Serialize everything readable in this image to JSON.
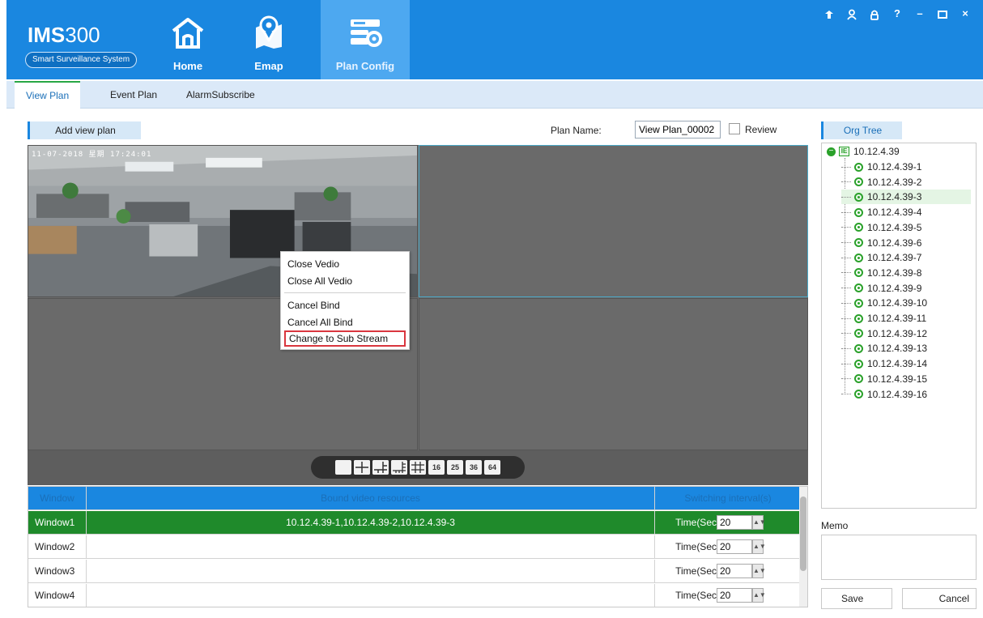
{
  "app": {
    "title_main": "IMS",
    "title_num": "300",
    "subtitle": "Smart Surveillance System"
  },
  "nav": [
    {
      "label": "Home",
      "icon": "home-icon"
    },
    {
      "label": "Emap",
      "icon": "map-pin-icon"
    },
    {
      "label": "Plan Config",
      "icon": "plan-config-icon",
      "active": true
    }
  ],
  "window_controls": [
    "pin-icon",
    "user-icon",
    "lock-icon",
    "help-icon",
    "minimize-icon",
    "maximize-icon",
    "close-icon"
  ],
  "window_controls_text": {
    "help": "?",
    "minimize": "–",
    "close": "×"
  },
  "tabs": [
    {
      "label": "View Plan",
      "active": true
    },
    {
      "label": "Event Plan"
    },
    {
      "label": "AlarmSubscribe"
    }
  ],
  "plan": {
    "add_button": "Add view plan",
    "name_label": "Plan Name:",
    "name_value": "View Plan_00002",
    "review_label": "Review",
    "review_checked": false
  },
  "video": {
    "osd_text": "11-07-2018 星期 17:24:01",
    "layout_buttons": [
      "1",
      "4",
      "6",
      "8",
      "9",
      "16",
      "25",
      "36",
      "64"
    ],
    "layout_button_labels": {
      "16": "16",
      "25": "25",
      "36": "36",
      "64": "64"
    }
  },
  "context_menu": {
    "items": [
      "Close Vedio",
      "Close All Vedio",
      "Cancel Bind",
      "Cancel All Bind",
      "Change to Sub Stream"
    ],
    "highlighted": "Change to Sub Stream"
  },
  "table": {
    "headers": {
      "window": "Window",
      "resources": "Bound video resources",
      "interval": "Switching interval(s)"
    },
    "rows": [
      {
        "window": "Window1",
        "resources": "10.12.4.39-1,10.12.4.39-2,10.12.4.39-3",
        "time_label": "Time(Sec",
        "time_value": "20",
        "active": true
      },
      {
        "window": "Window2",
        "resources": "",
        "time_label": "Time(Sec",
        "time_value": "20"
      },
      {
        "window": "Window3",
        "resources": "",
        "time_label": "Time(Sec",
        "time_value": "20"
      },
      {
        "window": "Window4",
        "resources": "",
        "time_label": "Time(Sec",
        "time_value": "20"
      }
    ]
  },
  "org_tree": {
    "title": "Org Tree",
    "root": "10.12.4.39",
    "root_icon_text": "IE",
    "children": [
      "10.12.4.39-1",
      "10.12.4.39-2",
      "10.12.4.39-3",
      "10.12.4.39-4",
      "10.12.4.39-5",
      "10.12.4.39-6",
      "10.12.4.39-7",
      "10.12.4.39-8",
      "10.12.4.39-9",
      "10.12.4.39-10",
      "10.12.4.39-11",
      "10.12.4.39-12",
      "10.12.4.39-13",
      "10.12.4.39-14",
      "10.12.4.39-15",
      "10.12.4.39-16"
    ],
    "selected": "10.12.4.39-3"
  },
  "memo": {
    "label": "Memo",
    "value": ""
  },
  "actions": {
    "save": "Save",
    "cancel": "Cancel"
  },
  "colors": {
    "brand": "#1a87e0",
    "active_row": "#1f8a2b",
    "accent_green": "#2aa12a",
    "highlight_red": "#d9363e"
  }
}
